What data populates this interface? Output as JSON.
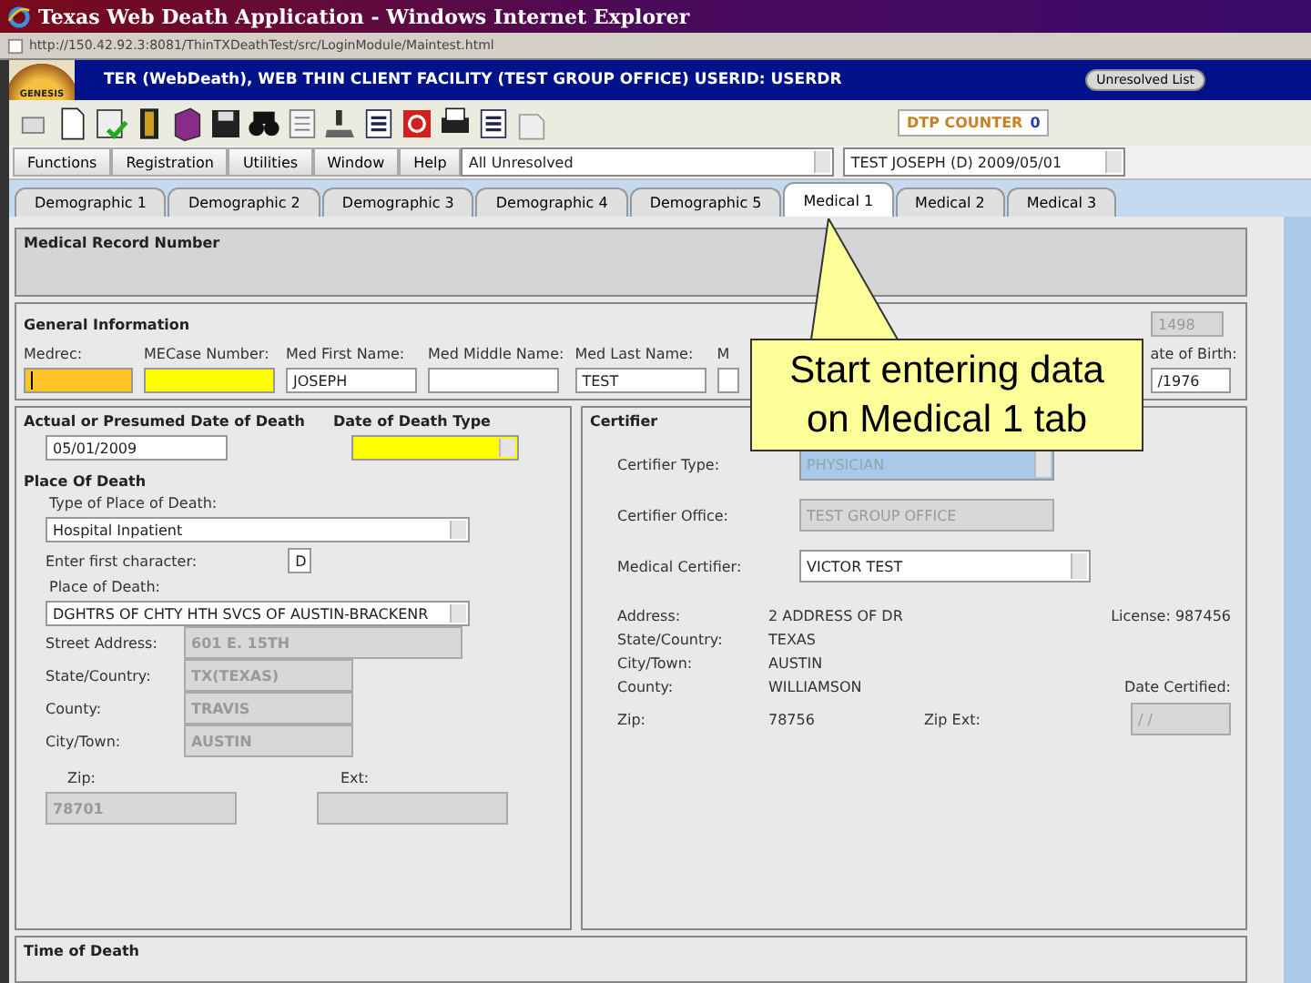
{
  "window": {
    "title": "Texas Web Death Application - Windows Internet Explorer"
  },
  "address_bar": {
    "url": "http://150.42.92.3:8081/ThinTXDeathTest/src/LoginModule/Maintest.html"
  },
  "header": {
    "logo": "GENESIS",
    "title": "TER (WebDeath), WEB THIN CLIENT FACILITY (TEST GROUP OFFICE) USERID: USERDR",
    "unresolved_button": "Unresolved List",
    "counter_label": "DTP COUNTER",
    "counter_value": "0"
  },
  "menu": [
    "Functions",
    "Registration",
    "Utilities",
    "Window",
    "Help"
  ],
  "record_selector": {
    "filter": "All Unresolved",
    "record": "TEST JOSEPH (D) 2009/05/01"
  },
  "tabs": [
    {
      "label": "Demographic 1",
      "selected": false
    },
    {
      "label": "Demographic 2",
      "selected": false
    },
    {
      "label": "Demographic 3",
      "selected": false
    },
    {
      "label": "Demographic 4",
      "selected": false
    },
    {
      "label": "Demographic 5",
      "selected": false
    },
    {
      "label": "Medical 1",
      "selected": true
    },
    {
      "label": "Medical 2",
      "selected": false
    },
    {
      "label": "Medical 3",
      "selected": false
    }
  ],
  "medical_record_number": {
    "title": "Medical Record Number"
  },
  "general_information": {
    "title": "General Information",
    "record_id": "1498",
    "fields": [
      {
        "label": "Medrec:",
        "focused": true,
        "required": true
      },
      {
        "label": "MECase Number:",
        "focused": false,
        "required": true
      },
      {
        "label": "Med First Name:",
        "value": "JOSEPH",
        "focused": false,
        "required": false
      },
      {
        "label": "Med Middle Name:",
        "focused": false,
        "required": false
      },
      {
        "label": "Med Last Name:",
        "value": "TEST",
        "focused": false,
        "required": false
      },
      {
        "label": "M",
        "focused": false,
        "required": false
      },
      {
        "label": "ate of Birth:",
        "value": "/1976",
        "focused": false,
        "required": false
      }
    ]
  },
  "date_of_death": {
    "date_label": "Actual or Presumed Date of Death",
    "date_value": "05/01/2009",
    "type_label": "Date of Death Type",
    "type_required": true
  },
  "place_of_death": {
    "title": "Place Of Death",
    "type_label": "Type of Place of Death:",
    "type_value": "Hospital Inpatient",
    "first_char_label": "Enter first character:",
    "first_char_value": "D",
    "place_label": "Place of Death:",
    "place_value": "DGHTRS OF CHTY HTH SVCS OF AUSTIN-BRACKENR",
    "address": [
      {
        "label": "Street Address:",
        "value": "601 E. 15TH"
      },
      {
        "label": "State/Country:",
        "value": "TX(TEXAS)"
      },
      {
        "label": "County:",
        "value": "TRAVIS"
      },
      {
        "label": "City/Town:",
        "value": "AUSTIN"
      }
    ],
    "zip_label": "Zip:",
    "zip_value": "78701",
    "ext_label": "Ext:"
  },
  "certifier": {
    "title": "Certifier",
    "fields": [
      {
        "label": "Certifier Type:",
        "value": "PHYSICIAN",
        "kind": "select",
        "disabled": true
      },
      {
        "label": "Certifier Office:",
        "value": "TEST GROUP OFFICE",
        "kind": "input",
        "disabled": true
      },
      {
        "label": "Medical Certifier:",
        "value": "VICTOR TEST",
        "kind": "select",
        "disabled": false
      }
    ],
    "address_label": "Address:",
    "address_value": "2 ADDRESS OF DR",
    "license": "License: 987456",
    "state_label": "State/Country:",
    "state_value": "TEXAS",
    "city_label": "City/Town:",
    "city_value": "AUSTIN",
    "county_label": "County:",
    "county_value": "WILLIAMSON",
    "date_certified_label": "Date Certified:",
    "zip_label": "Zip:",
    "zip_value": "78756",
    "zip_ext_label": "Zip Ext:",
    "date_certified_value": "/ /"
  },
  "time_of_death": {
    "title": "Time of Death"
  },
  "callout": {
    "text": "Start entering data on Medical 1 tab"
  }
}
